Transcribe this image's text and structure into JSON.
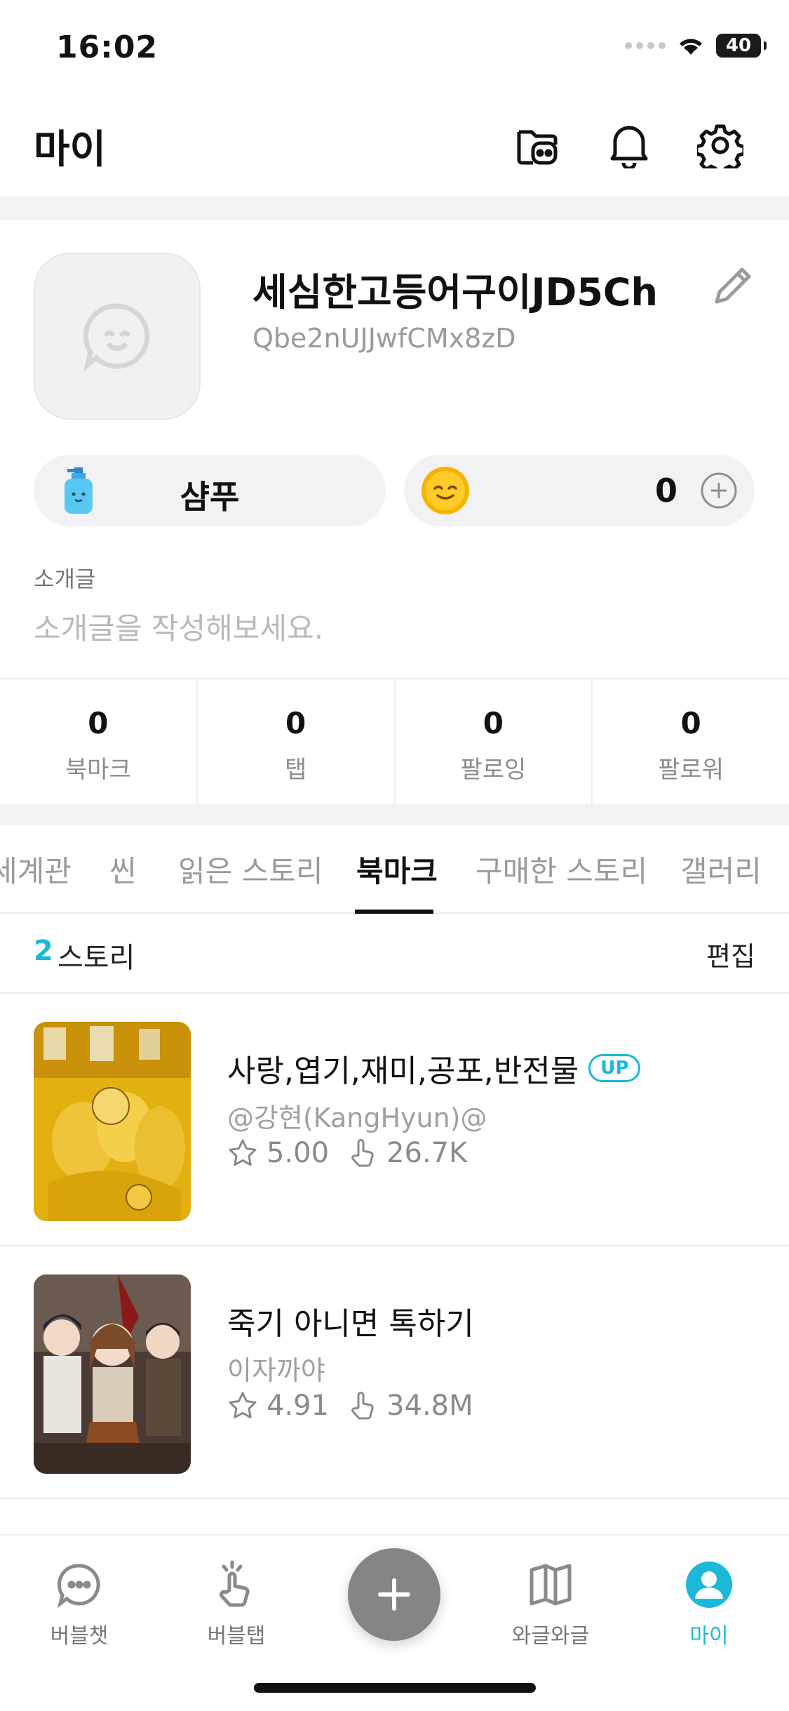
{
  "status_bar": {
    "time": "16:02",
    "battery": "40"
  },
  "header": {
    "title": "마이"
  },
  "profile": {
    "nickname": "세심한고등어구이JD5Ch",
    "user_id": "Qbe2nUJJwfCMx8zD",
    "shampoo_label": "샴푸",
    "coin_count": "0",
    "intro_label": "소개글",
    "intro_placeholder": "소개글을 작성해보세요."
  },
  "stats": [
    {
      "value": "0",
      "label": "북마크"
    },
    {
      "value": "0",
      "label": "탭"
    },
    {
      "value": "0",
      "label": "팔로잉"
    },
    {
      "value": "0",
      "label": "팔로워"
    }
  ],
  "tabs": [
    "세계관",
    "씬",
    "읽은 스토리",
    "북마크",
    "구매한 스토리",
    "갤러리"
  ],
  "active_tab": "북마크",
  "list_header": {
    "count": "2",
    "unit": "스토리",
    "edit": "편집"
  },
  "stories": [
    {
      "title": "사랑,엽기,재미,공포,반전물",
      "badge": "UP",
      "author": "@강현(KangHyun)@",
      "rating": "5.00",
      "taps": "26.7K"
    },
    {
      "title": "죽기 아니면 톡하기",
      "badge": "",
      "author": "이자까야",
      "rating": "4.91",
      "taps": "34.8M"
    }
  ],
  "bottom_nav": [
    {
      "label": "버블챗",
      "icon": "chat-bubble-icon"
    },
    {
      "label": "버블탭",
      "icon": "tap-hand-icon"
    },
    {
      "label": "와글와글",
      "icon": "book-open-icon"
    },
    {
      "label": "마이",
      "icon": "profile-icon"
    }
  ],
  "colors": {
    "accent": "#1cb8d8",
    "fab": "#858585",
    "band": "#f1f2f4"
  }
}
